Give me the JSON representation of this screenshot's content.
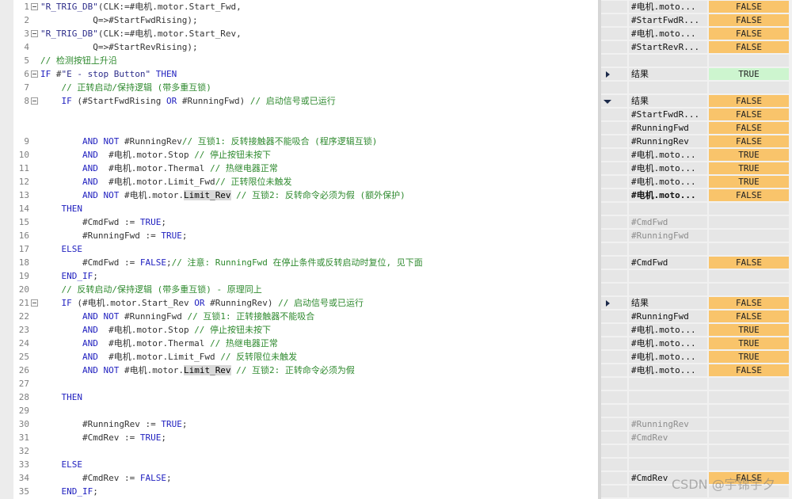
{
  "editor": {
    "lines": [
      {
        "num": "1",
        "fold": true,
        "parts": [
          [
            "str",
            "\"R_TRIG_DB\""
          ],
          [
            "id",
            "(CLK:=#电机.motor.Start_Fwd,"
          ]
        ]
      },
      {
        "num": "2",
        "fold": false,
        "parts": [
          [
            "id",
            "          Q=>#StartFwdRising);"
          ]
        ]
      },
      {
        "num": "3",
        "fold": true,
        "parts": [
          [
            "str",
            "\"R_TRIG_DB\""
          ],
          [
            "id",
            "(CLK:=#电机.motor.Start_Rev,"
          ]
        ]
      },
      {
        "num": "4",
        "fold": false,
        "parts": [
          [
            "id",
            "          Q=>#StartRevRising);"
          ]
        ]
      },
      {
        "num": "5",
        "fold": false,
        "parts": [
          [
            "cmt",
            "// 检测按钮上升沿"
          ]
        ]
      },
      {
        "num": "6",
        "fold": true,
        "parts": [
          [
            "kw",
            "IF "
          ],
          [
            "id",
            "#"
          ],
          [
            "str",
            "\"E - stop Button\""
          ],
          [
            "kw",
            " THEN"
          ]
        ]
      },
      {
        "num": "7",
        "fold": false,
        "parts": [
          [
            "cmt",
            "    // 正转启动/保持逻辑 (带多重互锁)"
          ]
        ]
      },
      {
        "num": "8",
        "fold": true,
        "parts": [
          [
            "kw",
            "    IF "
          ],
          [
            "id",
            "(#StartFwdRising "
          ],
          [
            "kw",
            "OR"
          ],
          [
            "id",
            " #RunningFwd) "
          ],
          [
            "cmt",
            "// 启动信号或已运行"
          ]
        ]
      },
      {
        "num": "",
        "fold": false,
        "parts": []
      },
      {
        "num": "",
        "fold": false,
        "parts": []
      },
      {
        "num": "9",
        "fold": false,
        "parts": [
          [
            "kw",
            "        AND NOT "
          ],
          [
            "id",
            "#RunningRev"
          ],
          [
            "cmt",
            "// 互锁1: 反转接触器不能吸合 (程序逻辑互锁)"
          ]
        ]
      },
      {
        "num": "10",
        "fold": false,
        "parts": [
          [
            "kw",
            "        AND  "
          ],
          [
            "id",
            "#电机.motor.Stop "
          ],
          [
            "cmt",
            "// 停止按钮未按下"
          ]
        ]
      },
      {
        "num": "11",
        "fold": false,
        "parts": [
          [
            "kw",
            "        AND  "
          ],
          [
            "id",
            "#电机.motor.Thermal "
          ],
          [
            "cmt",
            "// 热继电器正常"
          ]
        ]
      },
      {
        "num": "12",
        "fold": false,
        "parts": [
          [
            "kw",
            "        AND  "
          ],
          [
            "id",
            "#电机.motor.Limit_Fwd"
          ],
          [
            "cmt",
            "// 正转限位未触发"
          ]
        ]
      },
      {
        "num": "13",
        "fold": false,
        "parts": [
          [
            "kw",
            "        AND NOT "
          ],
          [
            "id",
            "#电机.motor."
          ],
          [
            "hl",
            "Limit_Rev"
          ],
          [
            "cmt",
            " // 互锁2: 反转命令必须为假 (额外保护)"
          ]
        ]
      },
      {
        "num": "14",
        "fold": false,
        "parts": [
          [
            "kw",
            "    THEN"
          ]
        ]
      },
      {
        "num": "15",
        "fold": false,
        "parts": [
          [
            "id",
            "        #CmdFwd := "
          ],
          [
            "kw",
            "TRUE"
          ],
          [
            "id",
            ";"
          ]
        ]
      },
      {
        "num": "16",
        "fold": false,
        "parts": [
          [
            "id",
            "        #RunningFwd := "
          ],
          [
            "kw",
            "TRUE"
          ],
          [
            "id",
            ";"
          ]
        ]
      },
      {
        "num": "17",
        "fold": false,
        "parts": [
          [
            "kw",
            "    ELSE"
          ]
        ]
      },
      {
        "num": "18",
        "fold": false,
        "parts": [
          [
            "id",
            "        #CmdFwd := "
          ],
          [
            "kw",
            "FALSE"
          ],
          [
            "id",
            ";"
          ],
          [
            "cmt",
            "// 注意: RunningFwd 在停止条件或反转启动时复位, 见下面"
          ]
        ]
      },
      {
        "num": "19",
        "fold": false,
        "parts": [
          [
            "kw",
            "    END_IF"
          ],
          [
            "id",
            ";"
          ]
        ]
      },
      {
        "num": "20",
        "fold": false,
        "parts": [
          [
            "cmt",
            "    // 反转启动/保持逻辑 (带多重互锁) - 原理同上"
          ]
        ]
      },
      {
        "num": "21",
        "fold": true,
        "parts": [
          [
            "kw",
            "    IF "
          ],
          [
            "id",
            "(#电机.motor.Start_Rev "
          ],
          [
            "kw",
            "OR"
          ],
          [
            "id",
            " #RunningRev) "
          ],
          [
            "cmt",
            "// 启动信号或已运行"
          ]
        ]
      },
      {
        "num": "22",
        "fold": false,
        "parts": [
          [
            "kw",
            "        AND NOT "
          ],
          [
            "id",
            "#RunningFwd "
          ],
          [
            "cmt",
            "// 互锁1: 正转接触器不能吸合"
          ]
        ]
      },
      {
        "num": "23",
        "fold": false,
        "parts": [
          [
            "kw",
            "        AND  "
          ],
          [
            "id",
            "#电机.motor.Stop "
          ],
          [
            "cmt",
            "// 停止按钮未按下"
          ]
        ]
      },
      {
        "num": "24",
        "fold": false,
        "parts": [
          [
            "kw",
            "        AND  "
          ],
          [
            "id",
            "#电机.motor.Thermal "
          ],
          [
            "cmt",
            "// 热继电器正常"
          ]
        ]
      },
      {
        "num": "25",
        "fold": false,
        "parts": [
          [
            "kw",
            "        AND  "
          ],
          [
            "id",
            "#电机.motor.Limit_Fwd "
          ],
          [
            "cmt",
            "// 反转限位未触发"
          ]
        ]
      },
      {
        "num": "26",
        "fold": false,
        "parts": [
          [
            "kw",
            "        AND NOT "
          ],
          [
            "id",
            "#电机.motor."
          ],
          [
            "hl",
            "Limit_Rev"
          ],
          [
            "cmt",
            " // 互锁2: 正转命令必须为假"
          ]
        ]
      },
      {
        "num": "27",
        "fold": false,
        "parts": []
      },
      {
        "num": "28",
        "fold": false,
        "parts": [
          [
            "kw",
            "    THEN"
          ]
        ]
      },
      {
        "num": "29",
        "fold": false,
        "parts": []
      },
      {
        "num": "30",
        "fold": false,
        "parts": [
          [
            "id",
            "        #RunningRev := "
          ],
          [
            "kw",
            "TRUE"
          ],
          [
            "id",
            ";"
          ]
        ]
      },
      {
        "num": "31",
        "fold": false,
        "parts": [
          [
            "id",
            "        #CmdRev := "
          ],
          [
            "kw",
            "TRUE"
          ],
          [
            "id",
            ";"
          ]
        ]
      },
      {
        "num": "32",
        "fold": false,
        "parts": []
      },
      {
        "num": "33",
        "fold": false,
        "parts": [
          [
            "kw",
            "    ELSE"
          ]
        ]
      },
      {
        "num": "34",
        "fold": false,
        "parts": [
          [
            "id",
            "        #CmdRev := "
          ],
          [
            "kw",
            "FALSE"
          ],
          [
            "id",
            ";"
          ]
        ]
      },
      {
        "num": "35",
        "fold": false,
        "parts": [
          [
            "kw",
            "    END_IF"
          ],
          [
            "id",
            ";"
          ]
        ]
      }
    ]
  },
  "watch": {
    "rows": [
      {
        "marker": "",
        "name": "#电机.moto...",
        "value": "FALSE",
        "style": "false"
      },
      {
        "marker": "",
        "name": "#StartFwdR...",
        "value": "FALSE",
        "style": "false"
      },
      {
        "marker": "",
        "name": "#电机.moto...",
        "value": "FALSE",
        "style": "false"
      },
      {
        "marker": "",
        "name": "#StartRevR...",
        "value": "FALSE",
        "style": "false"
      },
      {
        "marker": "",
        "name": "",
        "value": "",
        "style": "empty"
      },
      {
        "marker": "right",
        "name": "结果",
        "value": "TRUE",
        "style": "true-g"
      },
      {
        "marker": "",
        "name": "",
        "value": "",
        "style": "empty"
      },
      {
        "marker": "down",
        "name": "结果",
        "value": "FALSE",
        "style": "false"
      },
      {
        "marker": "",
        "name": "#StartFwdR...",
        "value": "FALSE",
        "style": "false"
      },
      {
        "marker": "",
        "name": "#RunningFwd",
        "value": "FALSE",
        "style": "false"
      },
      {
        "marker": "",
        "name": "#RunningRev",
        "value": "FALSE",
        "style": "false"
      },
      {
        "marker": "",
        "name": "#电机.moto...",
        "value": "TRUE",
        "style": "true-o"
      },
      {
        "marker": "",
        "name": "#电机.moto...",
        "value": "TRUE",
        "style": "true-o"
      },
      {
        "marker": "",
        "name": "#电机.moto...",
        "value": "TRUE",
        "style": "true-o"
      },
      {
        "marker": "",
        "name": "#电机.moto...",
        "value": "FALSE",
        "style": "false",
        "bold": true
      },
      {
        "marker": "",
        "name": "",
        "value": "",
        "style": "empty"
      },
      {
        "marker": "",
        "name": "#CmdFwd",
        "value": "",
        "style": "empty",
        "gray": true
      },
      {
        "marker": "",
        "name": "#RunningFwd",
        "value": "",
        "style": "empty",
        "gray": true
      },
      {
        "marker": "",
        "name": "",
        "value": "",
        "style": "empty"
      },
      {
        "marker": "",
        "name": "#CmdFwd",
        "value": "FALSE",
        "style": "false"
      },
      {
        "marker": "",
        "name": "",
        "value": "",
        "style": "empty"
      },
      {
        "marker": "",
        "name": "",
        "value": "",
        "style": "empty"
      },
      {
        "marker": "right",
        "name": "结果",
        "value": "FALSE",
        "style": "false"
      },
      {
        "marker": "",
        "name": "#RunningFwd",
        "value": "FALSE",
        "style": "false"
      },
      {
        "marker": "",
        "name": "#电机.moto...",
        "value": "TRUE",
        "style": "true-o"
      },
      {
        "marker": "",
        "name": "#电机.moto...",
        "value": "TRUE",
        "style": "true-o"
      },
      {
        "marker": "",
        "name": "#电机.moto...",
        "value": "TRUE",
        "style": "true-o"
      },
      {
        "marker": "",
        "name": "#电机.moto...",
        "value": "FALSE",
        "style": "false"
      },
      {
        "marker": "",
        "name": "",
        "value": "",
        "style": "empty"
      },
      {
        "marker": "",
        "name": "",
        "value": "",
        "style": "empty"
      },
      {
        "marker": "",
        "name": "",
        "value": "",
        "style": "empty"
      },
      {
        "marker": "",
        "name": "#RunningRev",
        "value": "",
        "style": "empty",
        "gray": true
      },
      {
        "marker": "",
        "name": "#CmdRev",
        "value": "",
        "style": "empty",
        "gray": true
      },
      {
        "marker": "",
        "name": "",
        "value": "",
        "style": "empty"
      },
      {
        "marker": "",
        "name": "",
        "value": "",
        "style": "empty"
      },
      {
        "marker": "",
        "name": "#CmdRev",
        "value": "FALSE",
        "style": "false"
      },
      {
        "marker": "",
        "name": "",
        "value": "",
        "style": "empty"
      }
    ]
  },
  "watermark": "CSDN @宇锦宇夕"
}
